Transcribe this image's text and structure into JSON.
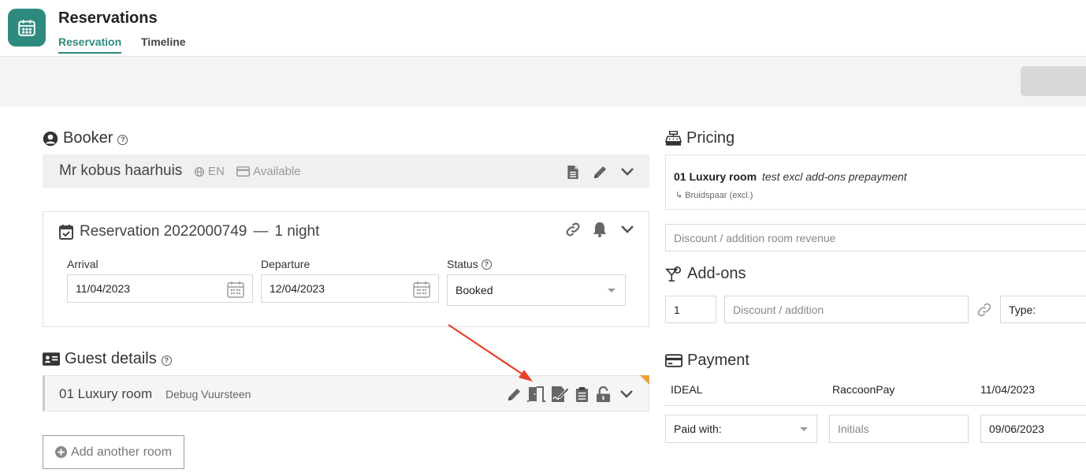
{
  "app": {
    "title": "Reservations",
    "tabs": [
      {
        "label": "Reservation",
        "active": true
      },
      {
        "label": "Timeline",
        "active": false
      }
    ],
    "accent_color": "#2e8a7f"
  },
  "booker": {
    "heading": "Booker",
    "name": "Mr kobus haarhuis",
    "language": "EN",
    "availability": "Available"
  },
  "reservation": {
    "title": "Reservation 2022000749",
    "nights": "1 night",
    "separator": "—",
    "arrival_label": "Arrival",
    "arrival_value": "11/04/2023",
    "departure_label": "Departure",
    "departure_value": "12/04/2023",
    "status_label": "Status",
    "status_value": "Booked"
  },
  "guest": {
    "heading": "Guest details",
    "room": "01 Luxury room",
    "guest_name": "Debug Vuursteen",
    "add_room_label": "Add another room"
  },
  "pricing": {
    "heading": "Pricing",
    "room": "01 Luxury room",
    "note": "test excl add-ons prepayment",
    "sub": "↳ Bruidspaar (excl.)",
    "discount_placeholder": "Discount / addition room revenue"
  },
  "addons": {
    "heading": "Add-ons",
    "quantity": "1",
    "discount_placeholder": "Discount / addition",
    "type_label": "Type:"
  },
  "payment": {
    "heading": "Payment",
    "method": "IDEAL",
    "provider": "RaccoonPay",
    "date": "11/04/2023",
    "paid_with_label": "Paid with:",
    "initials_placeholder": "Initials",
    "date_input": "09/06/2023"
  },
  "annotation": {
    "arrow_color": "#e8402b"
  }
}
